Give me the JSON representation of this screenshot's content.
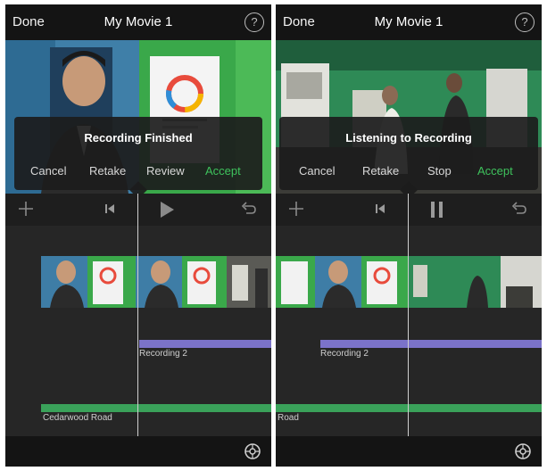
{
  "screens": [
    {
      "nav": {
        "done": "Done",
        "title": "My Movie 1",
        "help": "?"
      },
      "popup": {
        "title": "Recording Finished",
        "options": [
          "Cancel",
          "Retake",
          "Review",
          "Accept"
        ]
      },
      "timeline": {
        "recording_label": "Recording 2",
        "music_label": "Cedarwood Road"
      },
      "controls": [
        "add-icon",
        "skip-back-icon",
        "play-icon",
        "undo-icon"
      ]
    },
    {
      "nav": {
        "done": "Done",
        "title": "My Movie 1",
        "help": "?"
      },
      "popup": {
        "title": "Listening to Recording",
        "options": [
          "Cancel",
          "Retake",
          "Stop",
          "Accept"
        ]
      },
      "timeline": {
        "recording_label": "Recording 2",
        "music_label": "Road"
      },
      "controls": [
        "add-icon",
        "skip-back-icon",
        "pause-icon",
        "undo-icon"
      ]
    }
  ],
  "colors": {
    "accept": "#3ec25c",
    "recording_track": "#7b73c9",
    "music_track": "#3aa25a"
  }
}
